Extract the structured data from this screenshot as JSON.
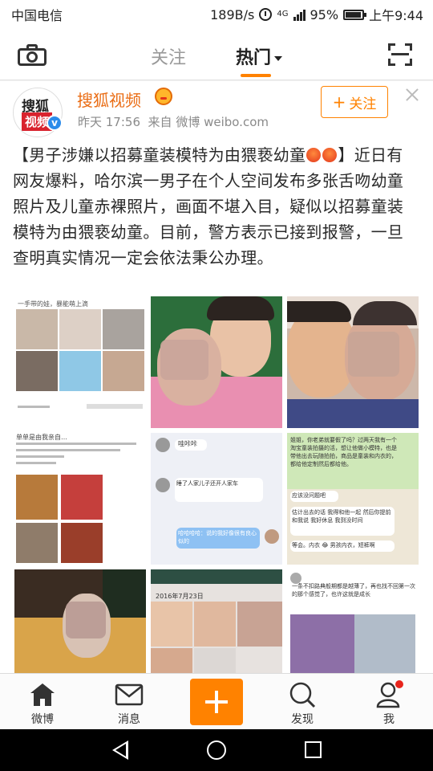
{
  "status_bar": {
    "carrier": "中国电信",
    "net_speed": "189B/s",
    "network": "4G",
    "battery": "95%",
    "battery_level": 0.95,
    "time": "上午9:44"
  },
  "header": {
    "tab_follow": "关注",
    "tab_hot": "热门",
    "active_tab": "热门"
  },
  "post": {
    "avatar_text_1": "搜狐",
    "avatar_text_2": "视频",
    "author": "搜狐视频",
    "time": "昨天 17:56",
    "source": "来自 微博 weibo.com",
    "follow_label": "关注",
    "text_part1": "【男子涉嫌以招募童装模特为由猥亵幼童",
    "text_part2": "】近日有网友爆料，哈尔滨一男子在个人空间发布多张舌吻幼童照片及儿童赤裸照片，画面不堪入目，疑似以招募童装模特为由猥亵幼童。目前，警方表示已接到报警，一旦查明真实情况一定会依法秉公办理。",
    "images": [
      {
        "caption": "一手带的娃，暴能萌上滴"
      },
      {
        "caption": ""
      },
      {
        "caption": ""
      },
      {
        "caption": "单单是由我亲自…"
      },
      {
        "caption": "哇咔咔"
      },
      {
        "caption": "姐姐，你老弟就要假了吗？过两天我有一个淘宝童装拍摄的活，想让他做小模特，也是带他出去玩随拍拍，商品是童装和内衣的，都给他定制然后都给他。"
      },
      {
        "caption": ""
      },
      {
        "caption": "2016年7月23日"
      },
      {
        "caption": "一条不扣路典般期都是越薄了，再也找不回第一次的那个感觉了，也许这就是成长"
      }
    ],
    "chat_lines": {
      "a": "睡了人家儿子还开人家车",
      "b": "哈哈哈哈：说的我好像很有良心似的",
      "c": "应该没问题吧",
      "d": "估计出去的话 我得和他一起 然后你提前和我说 我好休息 我到没时间",
      "e": "等会。内衣 😂 男孩内衣，短裤啊"
    }
  },
  "tabbar": {
    "items": [
      "微博",
      "消息",
      "发现",
      "我"
    ]
  },
  "colors": {
    "accent": "#ff8200",
    "author": "#ea6d15",
    "verified": "#2c8cea"
  }
}
